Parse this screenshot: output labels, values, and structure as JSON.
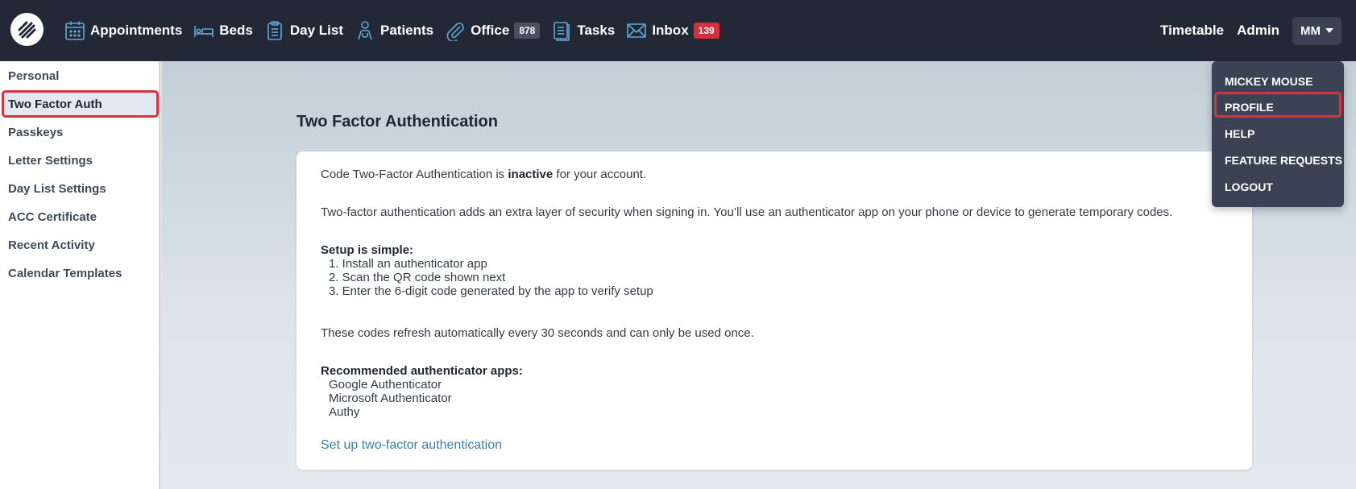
{
  "nav": {
    "items": [
      {
        "label": "Appointments",
        "icon": "calendar-icon"
      },
      {
        "label": "Beds",
        "icon": "bed-icon"
      },
      {
        "label": "Day List",
        "icon": "clipboard-icon"
      },
      {
        "label": "Patients",
        "icon": "patient-icon"
      },
      {
        "label": "Office",
        "icon": "paperclip-icon",
        "badge": "878"
      },
      {
        "label": "Tasks",
        "icon": "tasks-icon"
      },
      {
        "label": "Inbox",
        "icon": "envelope-icon",
        "badge": "139"
      }
    ],
    "right": {
      "timetable": "Timetable",
      "admin": "Admin",
      "user_initials": "MM"
    }
  },
  "sidebar": {
    "items": [
      {
        "label": "Personal"
      },
      {
        "label": "Two Factor Auth"
      },
      {
        "label": "Passkeys"
      },
      {
        "label": "Letter Settings"
      },
      {
        "label": "Day List Settings"
      },
      {
        "label": "ACC Certificate"
      },
      {
        "label": "Recent Activity"
      },
      {
        "label": "Calendar Templates"
      }
    ],
    "active": "Two Factor Auth"
  },
  "main": {
    "title": "Two Factor Authentication",
    "status_prefix": "Code Two-Factor Authentication is ",
    "status_value": "inactive",
    "status_suffix": " for your account.",
    "intro": "Two-factor authentication adds an extra layer of security when signing in. You’ll use an authenticator app on your phone or device to generate temporary codes.",
    "setup_heading": "Setup is simple:",
    "setup_steps": [
      "1. Install an authenticator app",
      "2. Scan the QR code shown next",
      "3. Enter the 6-digit code generated by the app to verify setup"
    ],
    "refresh_note": "These codes refresh automatically every 30 seconds and can only be used once.",
    "apps_heading": "Recommended authenticator apps:",
    "apps": [
      "Google Authenticator",
      "Microsoft Authenticator",
      "Authy"
    ],
    "setup_link": "Set up two-factor authentication"
  },
  "dropdown": {
    "user_name": "MICKEY MOUSE",
    "items": [
      {
        "label": "PROFILE"
      },
      {
        "label": "HELP"
      },
      {
        "label": "FEATURE REQUESTS"
      },
      {
        "label": "LOGOUT"
      }
    ]
  },
  "colors": {
    "topbar": "#222836",
    "accent_highlight": "#d9323d",
    "link": "#3c7fb1",
    "icon": "#5fa8dc"
  }
}
